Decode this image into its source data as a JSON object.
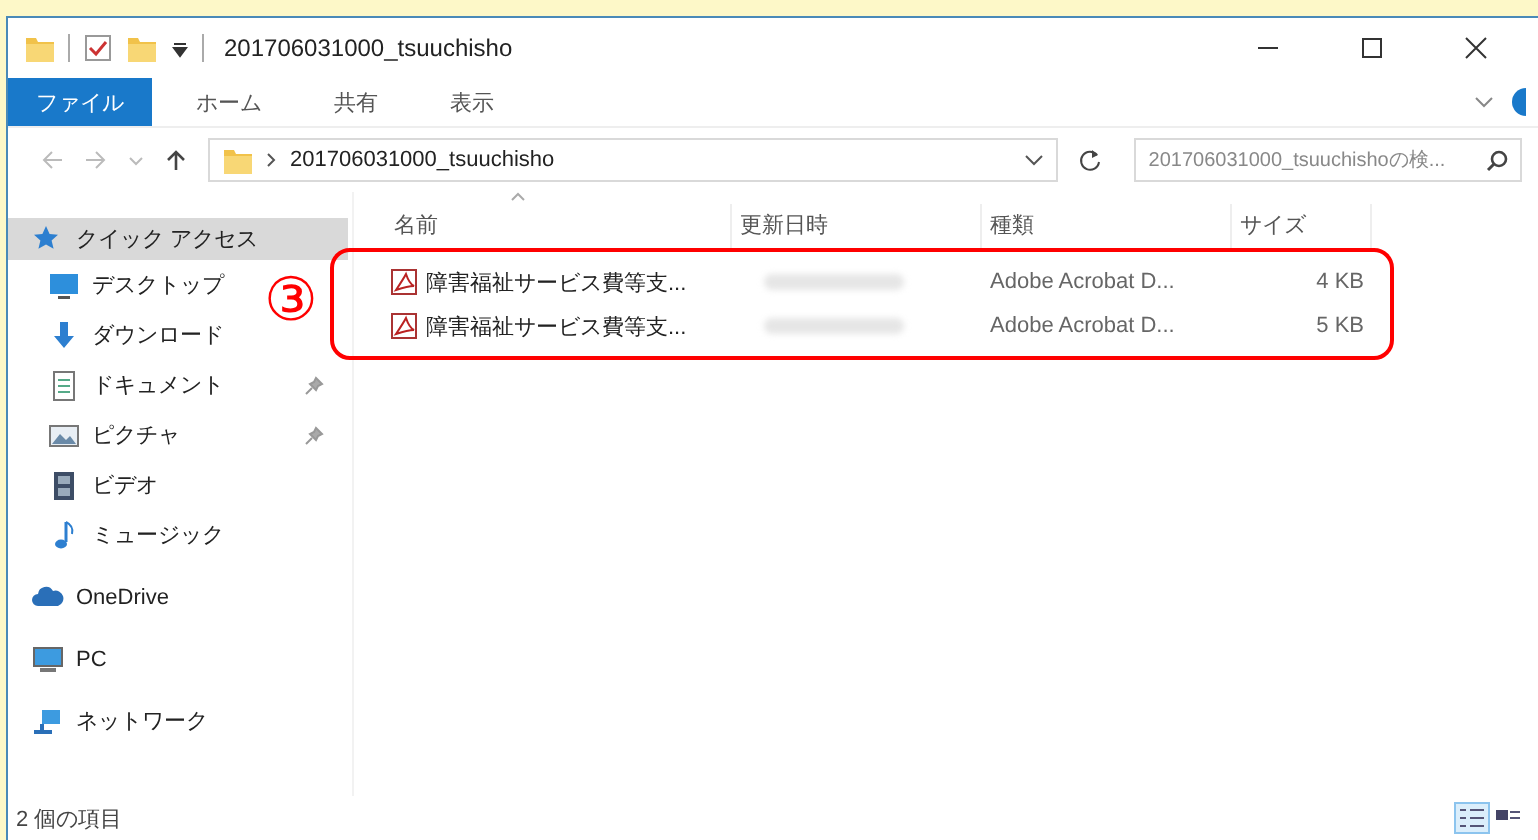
{
  "window": {
    "title": "201706031000_tsuuchisho"
  },
  "ribbon": {
    "tabs": [
      {
        "label": "ファイル",
        "selected": true
      },
      {
        "label": "ホーム",
        "selected": false
      },
      {
        "label": "共有",
        "selected": false
      },
      {
        "label": "表示",
        "selected": false
      }
    ]
  },
  "address_bar": {
    "path": "201706031000_tsuuchisho",
    "search": {
      "placeholder": "201706031000_tsuuchishoの検..."
    }
  },
  "sidebar": {
    "items": [
      {
        "label": "クイック アクセス",
        "kind": "star",
        "selected": true,
        "children": [
          {
            "label": "デスクトップ",
            "kind": "desktop",
            "selected": false,
            "pinned": false
          },
          {
            "label": "ダウンロード",
            "kind": "download",
            "selected": false,
            "pinned": false
          },
          {
            "label": "ドキュメント",
            "kind": "document",
            "selected": false,
            "pinned": true
          },
          {
            "label": "ピクチャ",
            "kind": "picture",
            "selected": false,
            "pinned": true
          },
          {
            "label": "ビデオ",
            "kind": "video",
            "selected": false,
            "pinned": false
          },
          {
            "label": "ミュージック",
            "kind": "music",
            "selected": false,
            "pinned": false
          }
        ]
      },
      {
        "label": "OneDrive",
        "kind": "cloud",
        "selected": false
      },
      {
        "label": "PC",
        "kind": "pc",
        "selected": false
      },
      {
        "label": "ネットワーク",
        "kind": "network",
        "selected": false
      }
    ]
  },
  "file_list": {
    "columns": [
      "名前",
      "更新日時",
      "種類",
      "サイズ"
    ],
    "rows": [
      {
        "name": "障害福祉サービス費等支...",
        "type": "Adobe Acrobat D...",
        "size": "4 KB"
      },
      {
        "name": "障害福祉サービス費等支...",
        "type": "Adobe Acrobat D...",
        "size": "5 KB"
      }
    ],
    "annotation": "③"
  },
  "status_bar": {
    "text": "2 個の項目",
    "views": [
      {
        "kind": "details",
        "selected": true
      },
      {
        "kind": "tiles",
        "selected": false
      }
    ]
  }
}
